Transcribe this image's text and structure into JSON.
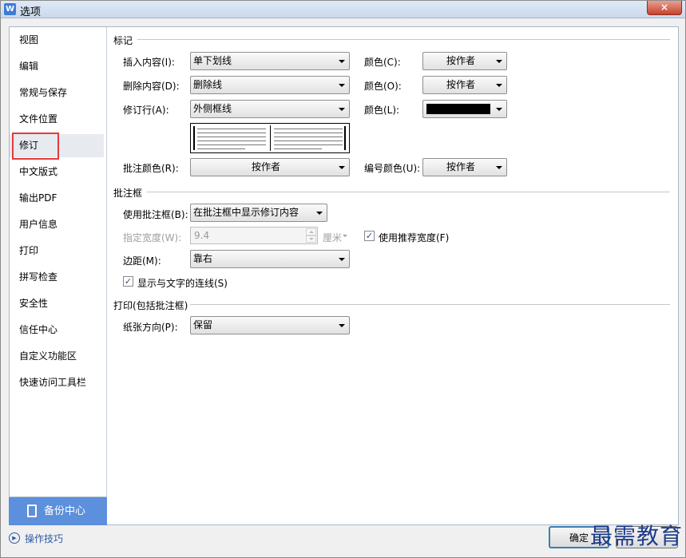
{
  "window": {
    "title": "选项",
    "app_icon": "W",
    "close": "×"
  },
  "sidebar": {
    "items": [
      {
        "label": "视图"
      },
      {
        "label": "编辑"
      },
      {
        "label": "常规与保存"
      },
      {
        "label": "文件位置"
      },
      {
        "label": "修订",
        "active": true
      },
      {
        "label": "中文版式"
      },
      {
        "label": "输出PDF"
      },
      {
        "label": "用户信息"
      },
      {
        "label": "打印"
      },
      {
        "label": "拼写检查"
      },
      {
        "label": "安全性"
      },
      {
        "label": "信任中心"
      },
      {
        "label": "自定义功能区"
      },
      {
        "label": "快速访问工具栏"
      }
    ],
    "backup_label": "备份中心",
    "tips_label": "操作技巧"
  },
  "markup": {
    "heading": "标记",
    "insert_label": "插入内容(I):",
    "insert_value": "单下划线",
    "insert_color_label": "颜色(C):",
    "insert_color_value": "按作者",
    "delete_label": "删除内容(D):",
    "delete_value": "删除线",
    "delete_color_label": "颜色(O):",
    "delete_color_value": "按作者",
    "revline_label": "修订行(A):",
    "revline_value": "外侧框线",
    "revline_color_label": "颜色(L):",
    "revline_color_value": "#000000",
    "comment_color_label": "批注颜色(R):",
    "comment_color_value": "按作者",
    "number_color_label": "编号颜色(U):",
    "number_color_value": "按作者"
  },
  "balloons": {
    "heading": "批注框",
    "use_label": "使用批注框(B):",
    "use_value": "在批注框中显示修订内容",
    "width_label": "指定宽度(W):",
    "width_value": "9.4",
    "width_unit": "厘米",
    "recommended_label": "使用推荐宽度(F)",
    "recommended_checked": true,
    "margin_label": "边距(M):",
    "margin_value": "靠右",
    "show_lines_label": "显示与文字的连线(S)",
    "show_lines_checked": true
  },
  "printing": {
    "heading": "打印(包括批注框)",
    "orientation_label": "纸张方向(P):",
    "orientation_value": "保留"
  },
  "footer": {
    "ok_label": "确定",
    "watermark": "最需教育"
  }
}
